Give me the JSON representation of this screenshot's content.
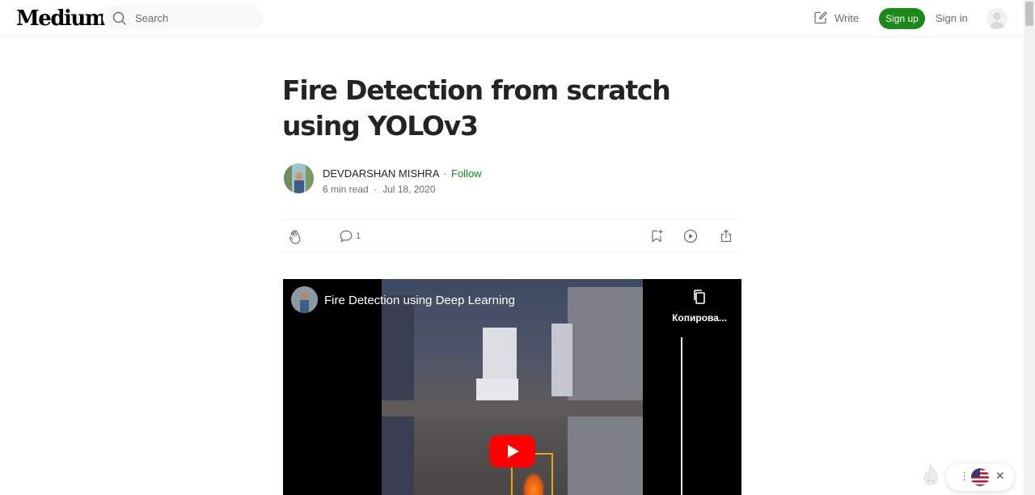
{
  "header": {
    "logo": "Medium",
    "search_placeholder": "Search",
    "write_label": "Write",
    "signup_label": "Sign up",
    "signin_label": "Sign in"
  },
  "article": {
    "title": "Fire Detection from scratch using YOLOv3",
    "author": "DEVDARSHAN MISHRA",
    "follow_label": "Follow",
    "read_time": "6 min read",
    "date": "Jul 18, 2020",
    "responses_count": "1"
  },
  "video": {
    "title": "Fire Detection using Deep Learning",
    "copy_label": "Копирова..."
  },
  "colors": {
    "brand_green": "#1a8917",
    "text_primary": "#242424",
    "text_secondary": "#6b6b6b",
    "youtube_red": "#ff0000"
  }
}
